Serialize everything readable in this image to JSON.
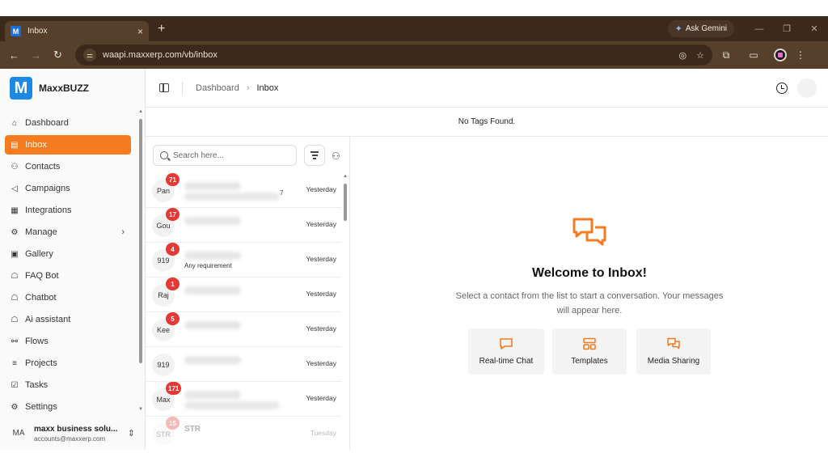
{
  "browser": {
    "tab_title": "Inbox",
    "tab_close": "×",
    "new_tab": "+",
    "favicon_letter": "M",
    "gemini_label": "Ask Gemini",
    "url": "waapi.maxxerp.com/vb/inbox",
    "win_minimize": "—",
    "win_restore": "❐",
    "win_close": "✕",
    "nav_back": "←",
    "nav_forward": "→",
    "nav_reload": "↻",
    "ext_more": "⋮"
  },
  "brand": {
    "name": "MaxxBUZZ",
    "logo_letter": "M",
    "accent": "#f47b20",
    "logo_color": "#1e88e5"
  },
  "sidebar": {
    "items": [
      {
        "label": "Dashboard",
        "icon": "home-icon",
        "glyph": "⌂"
      },
      {
        "label": "Inbox",
        "icon": "inbox-icon",
        "glyph": "▤",
        "active": true
      },
      {
        "label": "Contacts",
        "icon": "contacts-icon",
        "glyph": "⚇"
      },
      {
        "label": "Campaigns",
        "icon": "megaphone-icon",
        "glyph": "◁"
      },
      {
        "label": "Integrations",
        "icon": "integrations-icon",
        "glyph": "▦"
      },
      {
        "label": "Manage",
        "icon": "gear-icon",
        "glyph": "⚙",
        "has_chevron": true
      },
      {
        "label": "Gallery",
        "icon": "gallery-icon",
        "glyph": "▣"
      },
      {
        "label": "FAQ Bot",
        "icon": "bot-icon",
        "glyph": "☖"
      },
      {
        "label": "Chatbot",
        "icon": "chatbot-icon",
        "glyph": "☖"
      },
      {
        "label": "Ai assistant",
        "icon": "assistant-icon",
        "glyph": "☖"
      },
      {
        "label": "Flows",
        "icon": "flows-icon",
        "glyph": "⚯"
      },
      {
        "label": "Projects",
        "icon": "projects-icon",
        "glyph": "≡"
      },
      {
        "label": "Tasks",
        "icon": "tasks-icon",
        "glyph": "☑"
      },
      {
        "label": "Settings",
        "icon": "settings-icon",
        "glyph": "⚙"
      }
    ],
    "chevron": "›"
  },
  "user": {
    "initials": "MA",
    "name": "maxx business solu...",
    "email": "accounts@maxxerp.com",
    "switch_glyph": "⌃"
  },
  "header": {
    "breadcrumb_root": "Dashboard",
    "breadcrumb_sep": "›",
    "breadcrumb_current": "Inbox"
  },
  "tags": {
    "empty_text": "No Tags Found."
  },
  "contacts": {
    "search_placeholder": "Search here...",
    "people_glyph": "⚇",
    "rows": [
      {
        "initials": "Pan",
        "badge": "71",
        "time": "Yesterday",
        "tail": "7"
      },
      {
        "initials": "Gou",
        "badge": "17",
        "time": "Yesterday"
      },
      {
        "initials": "919",
        "badge": "4",
        "time": "Yesterday",
        "sub": "Any requirement"
      },
      {
        "initials": "Raj",
        "badge": "1",
        "time": "Yesterday"
      },
      {
        "initials": "Kee",
        "badge": "5",
        "time": "Yesterday"
      },
      {
        "initials": "919",
        "badge": "",
        "time": "Yesterday"
      },
      {
        "initials": "Max",
        "badge": "171",
        "time": "Yesterday"
      },
      {
        "initials": "STR",
        "badge": "15",
        "time": "Tuesday",
        "name": "STR"
      }
    ]
  },
  "welcome": {
    "title": "Welcome to Inbox!",
    "subtitle": "Select a contact from the list to start a conversation. Your messages will appear here.",
    "features": [
      {
        "label": "Real-time Chat",
        "icon": "chat-icon"
      },
      {
        "label": "Templates",
        "icon": "templates-icon"
      },
      {
        "label": "Media Sharing",
        "icon": "media-icon"
      }
    ]
  }
}
